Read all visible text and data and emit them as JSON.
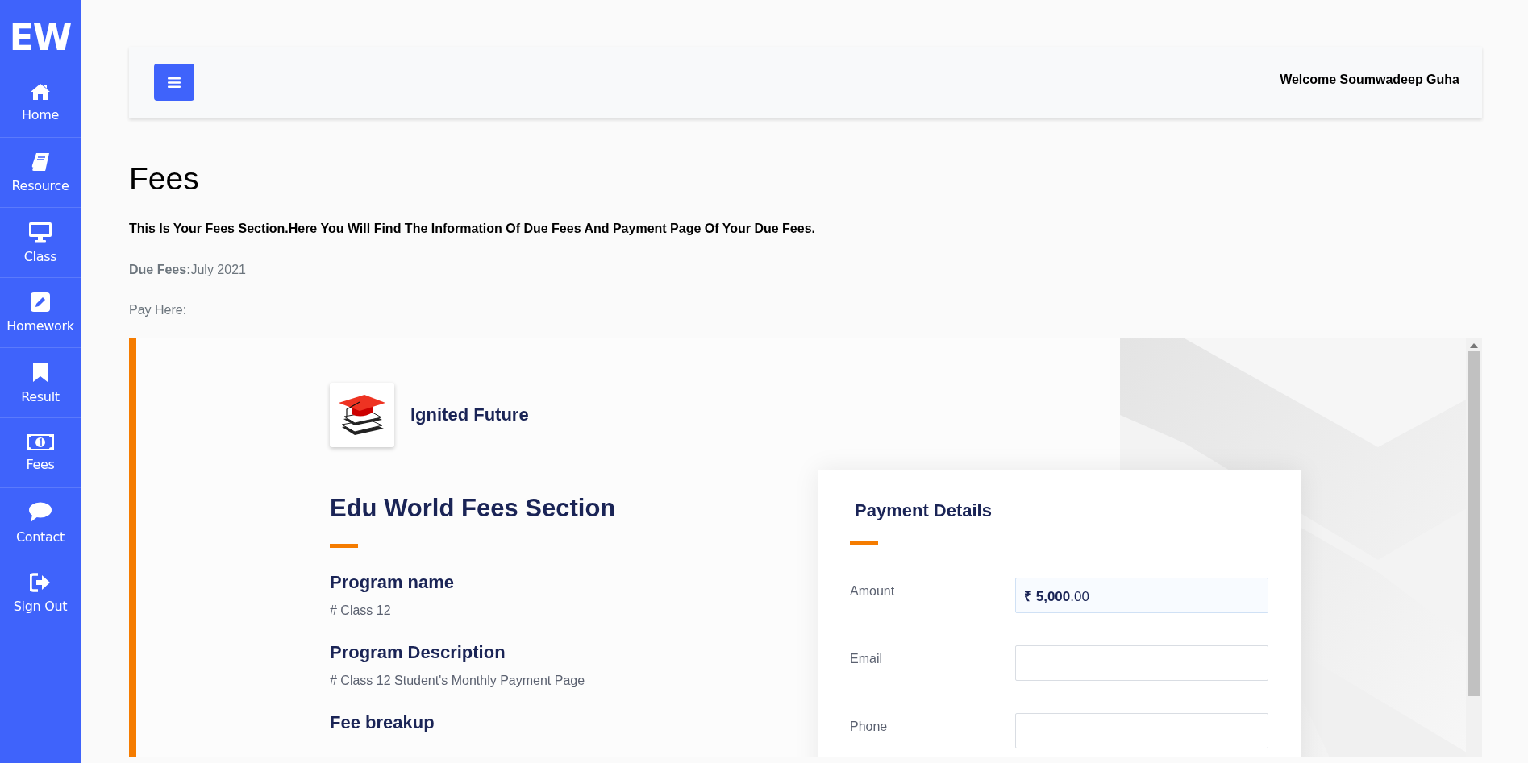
{
  "sidebar": {
    "logo": "EW",
    "items": [
      {
        "label": "Home"
      },
      {
        "label": "Resource"
      },
      {
        "label": "Class"
      },
      {
        "label": "Homework"
      },
      {
        "label": "Result"
      },
      {
        "label": "Fees"
      },
      {
        "label": "Contact"
      },
      {
        "label": "Sign Out"
      }
    ]
  },
  "header": {
    "welcome": "Welcome Soumwadeep Guha"
  },
  "page": {
    "title": "Fees",
    "intro": "This Is Your Fees Section.Here You Will Find The Information Of Due Fees And Payment Page Of Your Due Fees.",
    "due_label": "Due Fees:",
    "due_value": "July 2021",
    "pay_label": "Pay Here:"
  },
  "payment_page": {
    "brand": "Ignited Future",
    "heading": "Edu World Fees Section",
    "sections": [
      {
        "title": "Program name",
        "text": "# Class 12"
      },
      {
        "title": "Program Description",
        "text": "# Class 12 Student's Monthly Payment Page"
      },
      {
        "title": "Fee breakup"
      }
    ],
    "card": {
      "title": "Payment Details",
      "fields": [
        {
          "label": "Amount",
          "value": "**₹ 5,000**.00"
        },
        {
          "label": "Email"
        },
        {
          "label": "Phone"
        }
      ]
    }
  }
}
